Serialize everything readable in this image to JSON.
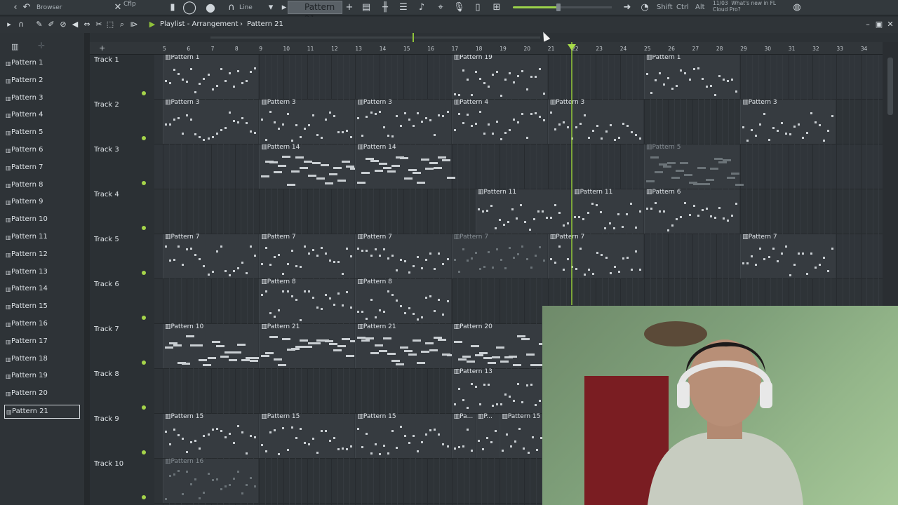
{
  "topbar": {
    "browser_label": "Browser",
    "flp_label": "Cflp",
    "line_mode": "Line",
    "pattern_selector": "Pattern 21",
    "news_date": "11/03",
    "news_title": "What's new in FL",
    "news_subtitle": "Cloud Pro?",
    "modifiers": [
      "Shift",
      "Ctrl",
      "Alt"
    ]
  },
  "toolbar": {
    "title": "Playlist - Arrangement",
    "separator": "›",
    "current_pattern": "Pattern 21"
  },
  "patterns": [
    "Pattern 1",
    "Pattern 2",
    "Pattern 3",
    "Pattern 4",
    "Pattern 5",
    "Pattern 6",
    "Pattern 7",
    "Pattern 8",
    "Pattern 9",
    "Pattern 10",
    "Pattern 11",
    "Pattern 12",
    "Pattern 13",
    "Pattern 14",
    "Pattern 15",
    "Pattern 16",
    "Pattern 17",
    "Pattern 18",
    "Pattern 19",
    "Pattern 20",
    "Pattern 21"
  ],
  "selected_pattern_index": 20,
  "tracks": [
    "Track 1",
    "Track 2",
    "Track 3",
    "Track 4",
    "Track 5",
    "Track 6",
    "Track 7",
    "Track 8",
    "Track 9",
    "Track 10"
  ],
  "ruler": [
    "5",
    "6",
    "7",
    "8",
    "9",
    "10",
    "11",
    "12",
    "13",
    "14",
    "15",
    "16",
    "17",
    "18",
    "19",
    "20",
    "21",
    "22",
    "23",
    "24",
    "25",
    "26",
    "27",
    "28",
    "29",
    "30",
    "31",
    "32",
    "33",
    "34"
  ],
  "clips": [
    {
      "track": 0,
      "bar": 5,
      "len": 4,
      "name": "Pattern 1"
    },
    {
      "track": 0,
      "bar": 17,
      "len": 4,
      "name": "Pattern 19"
    },
    {
      "track": 0,
      "bar": 25,
      "len": 4,
      "name": "Pattern 1"
    },
    {
      "track": 1,
      "bar": 5,
      "len": 4,
      "name": "Pattern 3"
    },
    {
      "track": 1,
      "bar": 9,
      "len": 4,
      "name": "Pattern 3"
    },
    {
      "track": 1,
      "bar": 13,
      "len": 4,
      "name": "Pattern 3"
    },
    {
      "track": 1,
      "bar": 17,
      "len": 4,
      "name": "Pattern 4"
    },
    {
      "track": 1,
      "bar": 21,
      "len": 4,
      "name": "Pattern 3"
    },
    {
      "track": 1,
      "bar": 29,
      "len": 4,
      "name": "Pattern 3"
    },
    {
      "track": 2,
      "bar": 9,
      "len": 4,
      "name": "Pattern 14"
    },
    {
      "track": 2,
      "bar": 13,
      "len": 4,
      "name": "Pattern 14"
    },
    {
      "track": 2,
      "bar": 25,
      "len": 4,
      "name": "Pattern 5",
      "ghost": true
    },
    {
      "track": 3,
      "bar": 18,
      "len": 4,
      "name": "Pattern 11"
    },
    {
      "track": 3,
      "bar": 22,
      "len": 3,
      "name": "Pattern 11"
    },
    {
      "track": 3,
      "bar": 25,
      "len": 4,
      "name": "Pattern 6"
    },
    {
      "track": 4,
      "bar": 5,
      "len": 4,
      "name": "Pattern 7"
    },
    {
      "track": 4,
      "bar": 9,
      "len": 4,
      "name": "Pattern 7"
    },
    {
      "track": 4,
      "bar": 13,
      "len": 4,
      "name": "Pattern 7"
    },
    {
      "track": 4,
      "bar": 17,
      "len": 4,
      "name": "Pattern 7",
      "ghost": true
    },
    {
      "track": 4,
      "bar": 21,
      "len": 4,
      "name": "Pattern 7"
    },
    {
      "track": 4,
      "bar": 29,
      "len": 4,
      "name": "Pattern 7"
    },
    {
      "track": 5,
      "bar": 9,
      "len": 4,
      "name": "Pattern 8"
    },
    {
      "track": 5,
      "bar": 13,
      "len": 4,
      "name": "Pattern 8"
    },
    {
      "track": 6,
      "bar": 5,
      "len": 4,
      "name": "Pattern 10"
    },
    {
      "track": 6,
      "bar": 9,
      "len": 4,
      "name": "Pattern 21"
    },
    {
      "track": 6,
      "bar": 13,
      "len": 4,
      "name": "Pattern 21"
    },
    {
      "track": 6,
      "bar": 17,
      "len": 4,
      "name": "Pattern 20"
    },
    {
      "track": 7,
      "bar": 17,
      "len": 4,
      "name": "Pattern 13"
    },
    {
      "track": 8,
      "bar": 5,
      "len": 4,
      "name": "Pattern 15"
    },
    {
      "track": 8,
      "bar": 9,
      "len": 4,
      "name": "Pattern 15"
    },
    {
      "track": 8,
      "bar": 13,
      "len": 4,
      "name": "Pattern 15"
    },
    {
      "track": 8,
      "bar": 17,
      "len": 1,
      "name": "Pa..."
    },
    {
      "track": 8,
      "bar": 18,
      "len": 1,
      "name": "P..."
    },
    {
      "track": 8,
      "bar": 19,
      "len": 4,
      "name": "Pattern 15"
    },
    {
      "track": 9,
      "bar": 5,
      "len": 4,
      "name": "Pattern 16",
      "ghost": true
    }
  ],
  "colors": {
    "accent": "#a5d44a",
    "clip": "#363b40",
    "note": "#c9ced2"
  },
  "icons": [
    "arrow-icon",
    "play-icon",
    "pencil-icon",
    "paint-icon",
    "delete-icon",
    "mute-icon",
    "slip-icon",
    "slice-icon",
    "select-icon",
    "zoom-icon",
    "playback-icon",
    "record-icon",
    "metronome-icon",
    "snap-icon"
  ]
}
